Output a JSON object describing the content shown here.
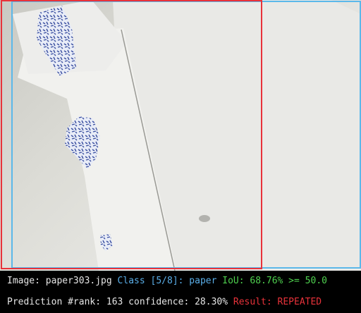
{
  "image_line": {
    "image_label": "Image: paper303.jpg",
    "class_label": "Class [5/8]: paper",
    "iou_label": "IoU: 68.76% >= 50.0"
  },
  "prediction_line": {
    "prediction_label": "Prediction #rank: 163 confidence: 28.30%",
    "result_label": "Result: REPEATED"
  },
  "colors": {
    "ground_truth_box": "#5bb8ea",
    "prediction_box": "#e8323a",
    "text_white": "#e6e6e6",
    "text_blue": "#5aaee8",
    "text_green": "#4fd14f",
    "text_red": "#e8323a"
  }
}
